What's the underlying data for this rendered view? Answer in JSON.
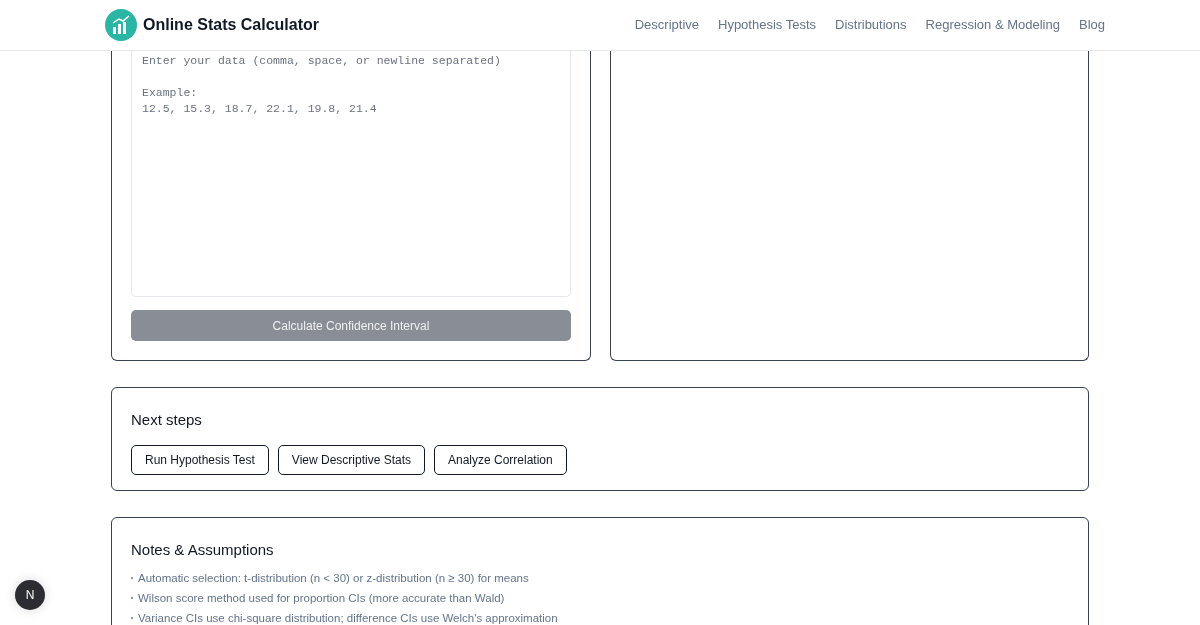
{
  "header": {
    "title": "Online Stats Calculator",
    "nav": [
      {
        "label": "Descriptive"
      },
      {
        "label": "Hypothesis Tests"
      },
      {
        "label": "Distributions"
      },
      {
        "label": "Regression & Modeling"
      },
      {
        "label": "Blog"
      }
    ]
  },
  "calculator": {
    "data_input": {
      "placeholder": "Enter your data (comma, space, or newline separated)\n\nExample:\n12.5, 15.3, 18.7, 22.1, 19.8, 21.4"
    },
    "button": {
      "label": "Calculate Confidence Interval",
      "disabled": true
    }
  },
  "next_steps": {
    "title": "Next steps",
    "buttons": [
      {
        "label": "Run Hypothesis Test"
      },
      {
        "label": "View Descriptive Stats"
      },
      {
        "label": "Analyze Correlation"
      }
    ]
  },
  "notes": {
    "title": "Notes & Assumptions",
    "items": [
      "Automatic selection: t-distribution (n < 30) or z-distribution (n ≥ 30) for means",
      "Wilson score method used for proportion CIs (more accurate than Wald)",
      "Variance CIs use chi-square distribution; difference CIs use Welch's approximation"
    ]
  },
  "dev_badge": {
    "label": "N"
  }
}
